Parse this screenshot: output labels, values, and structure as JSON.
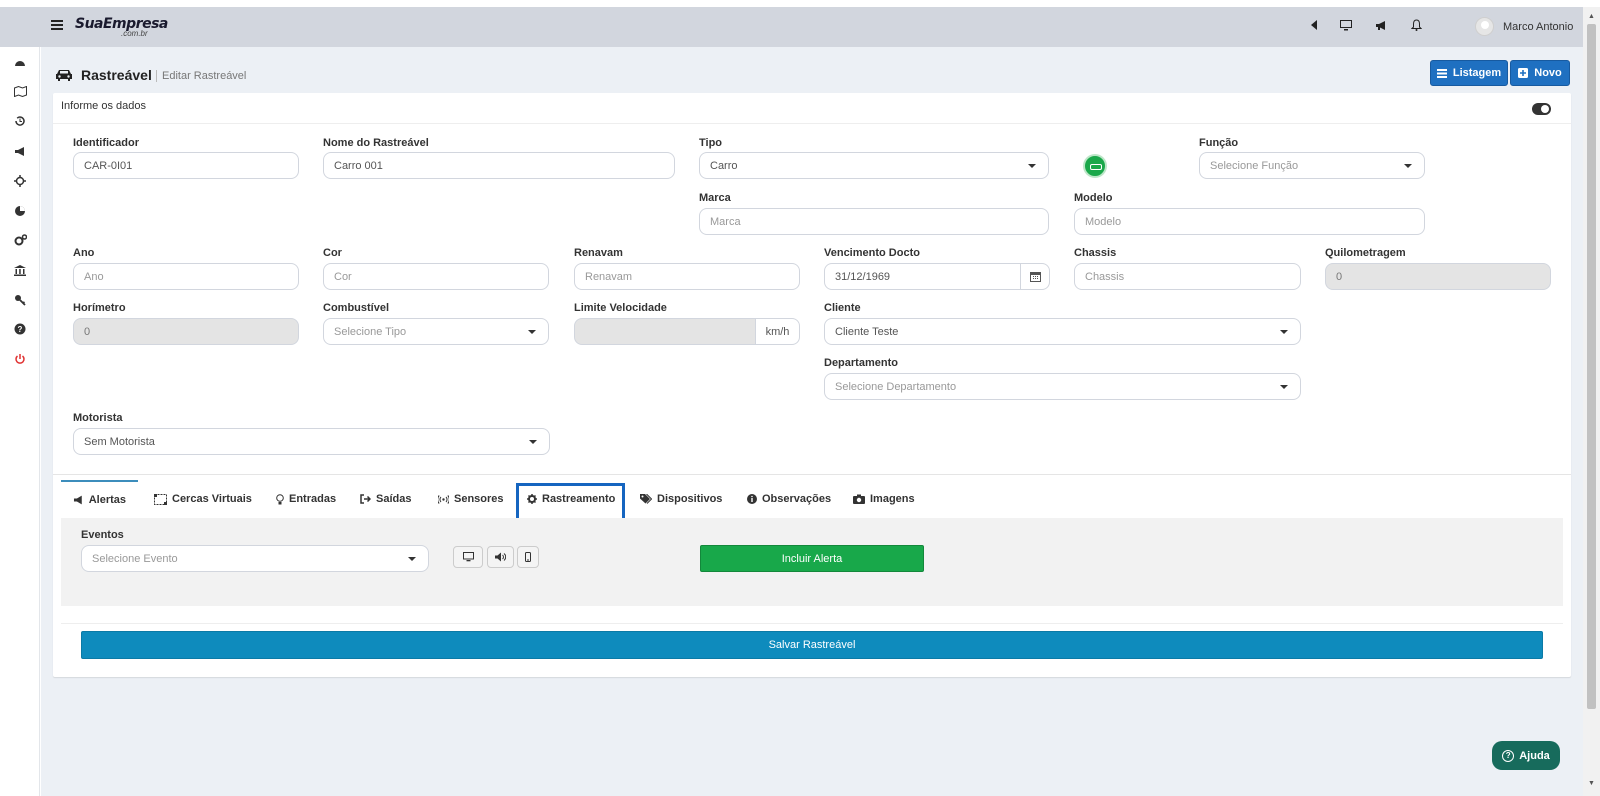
{
  "topbar": {
    "logo": "SuaEmpresa",
    "logo_sub": ".com.br",
    "user_name": "Marco Antonio",
    "icons": [
      "caret-left-icon",
      "monitor-icon",
      "megaphone-icon",
      "bell-icon"
    ]
  },
  "sidebar": {
    "items": [
      "dashboard-icon",
      "map-icon",
      "history-icon",
      "megaphone-icon",
      "crosshair-icon",
      "pie-chart-icon",
      "gears-icon",
      "bank-icon",
      "key-icon",
      "question-icon",
      "power-icon"
    ]
  },
  "page": {
    "title": "Rastreável",
    "subtitle": "Editar Rastreável",
    "listagem_label": "Listagem",
    "novo_label": "Novo"
  },
  "form": {
    "card_title": "Informe os dados",
    "identificador": {
      "label": "Identificador",
      "value": "CAR-0I01"
    },
    "nome": {
      "label": "Nome do Rastreável",
      "value": "Carro 001"
    },
    "tipo": {
      "label": "Tipo",
      "value": "Carro"
    },
    "funcao": {
      "label": "Função",
      "placeholder": "Selecione Função"
    },
    "marca": {
      "label": "Marca",
      "placeholder": "Marca"
    },
    "modelo": {
      "label": "Modelo",
      "placeholder": "Modelo"
    },
    "ano": {
      "label": "Ano",
      "placeholder": "Ano"
    },
    "cor": {
      "label": "Cor",
      "placeholder": "Cor"
    },
    "renavam": {
      "label": "Renavam",
      "placeholder": "Renavam"
    },
    "vencimento": {
      "label": "Vencimento Docto",
      "value": "31/12/1969"
    },
    "chassis": {
      "label": "Chassis",
      "placeholder": "Chassis"
    },
    "quilometragem": {
      "label": "Quilometragem",
      "value": "0"
    },
    "horimetro": {
      "label": "Horímetro",
      "value": "0"
    },
    "combustivel": {
      "label": "Combustível",
      "placeholder": "Selecione Tipo"
    },
    "limite": {
      "label": "Limite Velocidade",
      "unit": "km/h"
    },
    "cliente": {
      "label": "Cliente",
      "value": "Cliente Teste"
    },
    "departamento": {
      "label": "Departamento",
      "placeholder": "Selecione Departamento"
    },
    "motorista": {
      "label": "Motorista",
      "value": "Sem Motorista"
    }
  },
  "tabs": [
    {
      "label": "Alertas",
      "icon": "megaphone-icon"
    },
    {
      "label": "Cercas Virtuais",
      "icon": "fence-icon"
    },
    {
      "label": "Entradas",
      "icon": "lightbulb-icon"
    },
    {
      "label": "Saídas",
      "icon": "sign-out-icon"
    },
    {
      "label": "Sensores",
      "icon": "signal-icon"
    },
    {
      "label": "Rastreamento",
      "icon": "gear-icon"
    },
    {
      "label": "Dispositivos",
      "icon": "tags-icon"
    },
    {
      "label": "Observações",
      "icon": "info-icon"
    },
    {
      "label": "Imagens",
      "icon": "camera-icon"
    }
  ],
  "alertas": {
    "eventos_label": "Eventos",
    "eventos_placeholder": "Selecione Evento",
    "include_label": "Incluir Alerta"
  },
  "save_label": "Salvar Rastreável",
  "help_label": "Ajuda",
  "colors": {
    "primary": "#1f70c1",
    "success": "#18a84a",
    "save": "#0e8bbd",
    "help": "#176b5c"
  }
}
